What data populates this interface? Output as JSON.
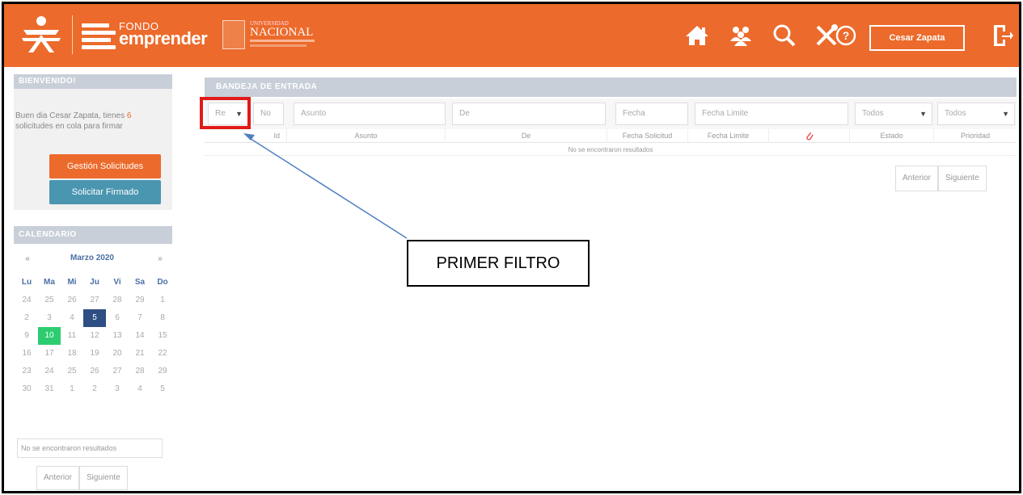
{
  "header": {
    "brand_small": "FONDO",
    "brand_big": "emprender",
    "university_line1": "UNIVERSIDAD",
    "university_line2": "NACIONAL",
    "user_name": "Cesar Zapata",
    "colors": {
      "bar": "#ec6a2b"
    },
    "icons": [
      "home-icon",
      "users-icon",
      "search-icon",
      "tools-icon",
      "help-icon",
      "exit-icon"
    ]
  },
  "sidebar": {
    "welcome_title": "BIENVENIDO!",
    "welcome_pre": "Buen dia Cesar Zapata, tienes ",
    "welcome_count": "6",
    "welcome_post": " solicitudes en cola para firmar",
    "btn_requests": "Gestión Solicitudes",
    "btn_sign": "Solicitar Firmado",
    "calendar_title": "CALENDARIO",
    "calendar": {
      "prev": "«",
      "next": "»",
      "month": "Marzo 2020",
      "weekdays": [
        "Lu",
        "Ma",
        "Mi",
        "Ju",
        "Vi",
        "Sa",
        "Do"
      ],
      "weeks": [
        [
          "24",
          "25",
          "26",
          "27",
          "28",
          "29",
          "1"
        ],
        [
          "2",
          "3",
          "4",
          "5",
          "6",
          "7",
          "8"
        ],
        [
          "9",
          "10",
          "11",
          "12",
          "13",
          "14",
          "15"
        ],
        [
          "16",
          "17",
          "18",
          "19",
          "20",
          "21",
          "22"
        ],
        [
          "23",
          "24",
          "25",
          "26",
          "27",
          "28",
          "29"
        ],
        [
          "30",
          "31",
          "1",
          "2",
          "3",
          "4",
          "5"
        ]
      ],
      "highlight_today": "5",
      "highlight_selected": "10"
    },
    "empty_results": "No se encontraron resultados",
    "prev_label": "Anterior",
    "next_label": "Siguiente"
  },
  "inbox": {
    "title": "BANDEJA DE ENTRADA",
    "filters": {
      "type_select": "Re",
      "no_placeholder": "No",
      "subject_placeholder": "Asunto",
      "from_placeholder": "De",
      "date_placeholder": "Fecha",
      "deadline_placeholder": "Fecha Limite",
      "status_select": "Todos",
      "priority_select": "Todos"
    },
    "columns": [
      "Id",
      "Asunto",
      "De",
      "Fecha Solicitud",
      "Fecha Limite",
      "",
      "Estado",
      "Prioridad"
    ],
    "empty_message": "No se encontraron resultados",
    "prev_label": "Anterior",
    "next_label": "Siguiente"
  },
  "annotation": {
    "label": "PRIMER FILTRO"
  }
}
